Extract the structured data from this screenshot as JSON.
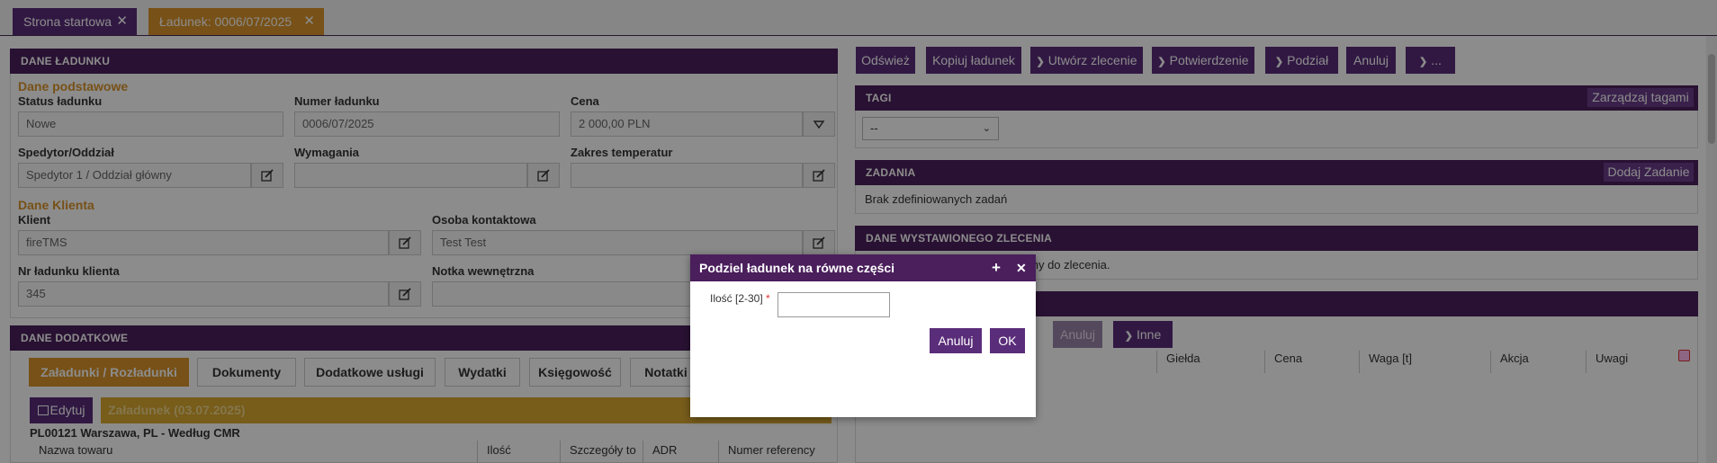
{
  "tabs": [
    {
      "label": "Strona startowa",
      "close": "✕"
    },
    {
      "label": "Ładunek: 0006/07/2025",
      "close": "✕"
    }
  ],
  "colors": {
    "purple_dark": "#4a1f5c",
    "purple_button": "#5a2d7a",
    "orange_tab": "#d9942a",
    "orange_label": "#d9942a"
  },
  "left": {
    "section_title": "DANE ŁADUNKU",
    "basic_group": "Dane podstawowe",
    "status_label": "Status ładunku",
    "status_value": "Nowe",
    "number_label": "Numer ładunku",
    "number_value": "0006/07/2025",
    "price_label": "Cena",
    "price_value": "2 000,00 PLN",
    "forwarder_label": "Spedytor/Oddział",
    "forwarder_value": "Spedytor 1 / Oddział główny",
    "requirements_label": "Wymagania",
    "temperature_label": "Zakres temperatur",
    "client_group": "Dane Klienta",
    "client_label": "Klient",
    "client_value": "fireTMS",
    "contact_label": "Osoba kontaktowa",
    "contact_value": "Test Test",
    "client_no_label": "Nr ładunku klienta",
    "client_no_value": "345",
    "internal_note_label": "Notka wewnętrzna"
  },
  "extra": {
    "section_title": "DANE DODATKOWE",
    "tabs": [
      "Załadunki / Rozładunki",
      "Dokumenty",
      "Dodatkowe usługi",
      "Wydatki",
      "Księgowość",
      "Notatki"
    ],
    "edit_button": "Edytuj",
    "loading_header": "Załadunek (03.07.2025)",
    "location": "PL00121 Warszawa, PL - Według CMR",
    "columns": [
      "Nazwa towaru",
      "Ilość",
      "Szczegóły tow",
      "ADR",
      "Numer referency"
    ]
  },
  "toolbar": {
    "refresh": "Odśwież",
    "copy": "Kopiuj ładunek",
    "create_order": "Utwórz zlecenie",
    "confirmation": "Potwierdzenie",
    "split": "Podział",
    "cancel": "Anuluj",
    "more": "..."
  },
  "tags": {
    "title": "TAGI",
    "manage": "Zarządzaj tagami",
    "select_value": "--"
  },
  "tasks": {
    "title": "ZADANIA",
    "add": "Dodaj Zadanie",
    "empty": "Brak zdefiniowanych zadań"
  },
  "order": {
    "title": "DANE WYSTAWIONEGO ZLECENIA",
    "text": "sany do zlecenia."
  },
  "exchange": {
    "cancel": "Anuluj",
    "other": "Inne",
    "columns": [
      "Giełda",
      "Cena",
      "Waga [t]",
      "Akcja",
      "Uwagi"
    ]
  },
  "modal": {
    "title": "Podziel ładunek na równe części",
    "plus": "+",
    "close": "✕",
    "qty_label": "Ilość [2-30]",
    "required_mark": "*",
    "qty_value": "",
    "cancel": "Anuluj",
    "ok": "OK"
  }
}
